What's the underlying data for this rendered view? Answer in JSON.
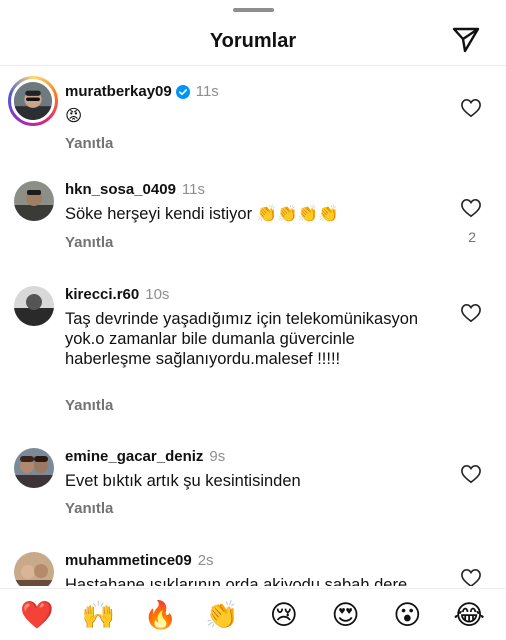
{
  "header": {
    "title": "Yorumlar"
  },
  "comments": [
    {
      "username": "muratberkay09",
      "verified": true,
      "time": "11s",
      "text": "😡",
      "reply": "Yanıtla",
      "likes": ""
    },
    {
      "username": "hkn_sosa_0409",
      "verified": false,
      "time": "11s",
      "text": "Söke herşeyi kendi istiyor 👏👏👏👏",
      "reply": "Yanıtla",
      "likes": "2"
    },
    {
      "username": "kirecci.r60",
      "verified": false,
      "time": "10s",
      "text": "Taş devrinde yaşadığımız için telekomünikasyon yok.o zamanlar bile dumanla güvercinle haberleşme sağlanıyordu.malesef !!!!!",
      "reply": "Yanıtla",
      "likes": ""
    },
    {
      "username": "emine_gacar_deniz",
      "verified": false,
      "time": "9s",
      "text": "Evet bıktık artık şu  kesintisinden",
      "reply": "Yanıtla",
      "likes": ""
    },
    {
      "username": "muhammetince09",
      "verified": false,
      "time": "2s",
      "text": "Hastahane ışıklarının orda akiyodu sabah dere",
      "reply": "",
      "likes": ""
    }
  ],
  "reactions": [
    "❤️",
    "🙌",
    "🔥",
    "👏",
    "😢",
    "😍",
    "😮",
    "😂"
  ],
  "colors": {
    "verified": "#0095f6",
    "muted": "#737373",
    "heart_red": "#ed4956"
  },
  "icons": {
    "share": "paper-plane-icon",
    "like": "heart-outline-icon",
    "verified": "verified-badge-icon"
  }
}
